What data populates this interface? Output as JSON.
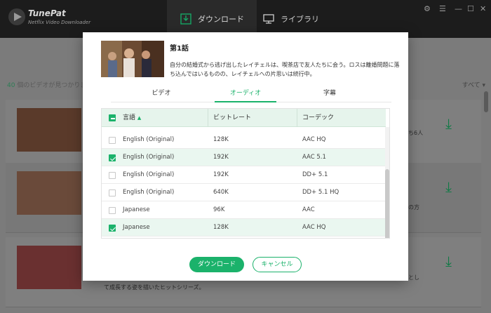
{
  "app": {
    "brand": "TunePat",
    "brand_sub": "Netflix Video Downloader",
    "tabs": [
      {
        "label": "ダウンロード",
        "active": true
      },
      {
        "label": "ライブラリ",
        "active": false
      }
    ],
    "window_controls": [
      "gear-icon",
      "menu-icon",
      "minimize-icon",
      "maximize-icon",
      "close-icon"
    ]
  },
  "background": {
    "found_count": "40",
    "found_text": "個のビデオが見つかりま",
    "sort_label": "すべて ▾",
    "side_texts": [
      "ち6人",
      "の方",
      "とし",
      "て成長する姿を描いたヒットシリーズ。"
    ]
  },
  "dialog": {
    "episode_title": "第1話",
    "episode_desc": "自分の結婚式から逃げ出したレイチェルは、喫茶店で友人たちに会う。ロスは離婚問題に落ち込んではいるものの、レイチェルへの片思いは続行中。",
    "tabs": [
      {
        "label": "ビデオ",
        "active": false
      },
      {
        "label": "オーディオ",
        "active": true
      },
      {
        "label": "字幕",
        "active": false
      }
    ],
    "table": {
      "headers": {
        "language": "言語",
        "bitrate": "ビットレート",
        "codec": "コーデック"
      },
      "rows": [
        {
          "language": "English (Original)",
          "bitrate": "128K",
          "codec": "AAC HQ",
          "checked": false
        },
        {
          "language": "English (Original)",
          "bitrate": "192K",
          "codec": "AAC 5.1",
          "checked": true
        },
        {
          "language": "English (Original)",
          "bitrate": "192K",
          "codec": "DD+ 5.1",
          "checked": false
        },
        {
          "language": "English (Original)",
          "bitrate": "640K",
          "codec": "DD+ 5.1 HQ",
          "checked": false
        },
        {
          "language": "Japanese",
          "bitrate": "96K",
          "codec": "AAC",
          "checked": false
        },
        {
          "language": "Japanese",
          "bitrate": "128K",
          "codec": "AAC HQ",
          "checked": true
        }
      ]
    },
    "buttons": {
      "download": "ダウンロード",
      "cancel": "キャンセル"
    }
  },
  "colors": {
    "accent": "#1bb26b",
    "header_bg": "#e6f4ec",
    "titlebar": "#1c1c1c"
  }
}
